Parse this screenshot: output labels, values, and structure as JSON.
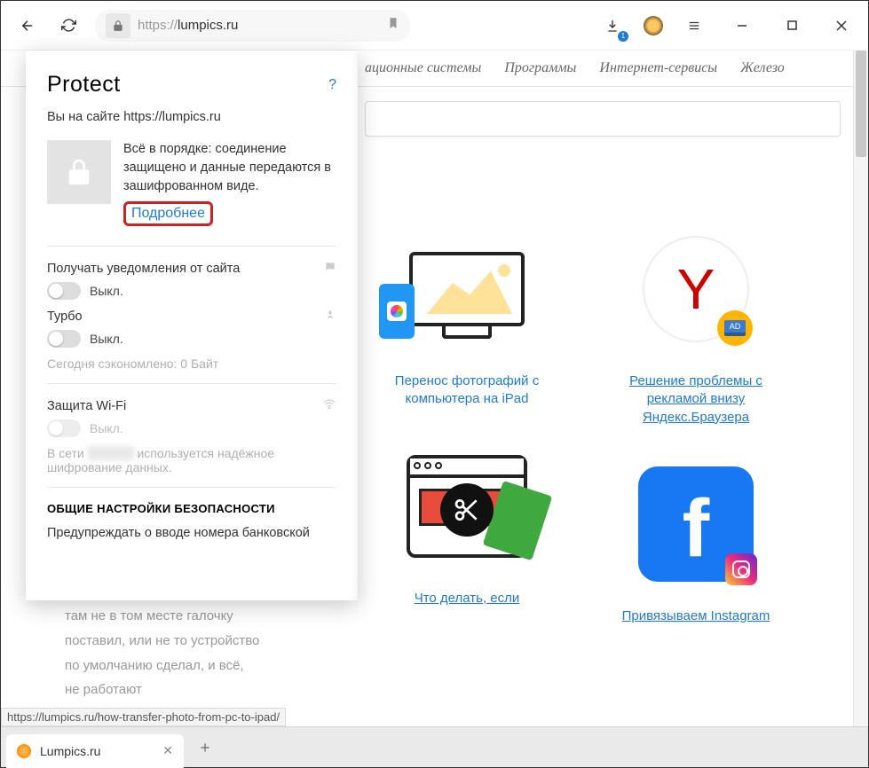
{
  "toolbar": {
    "url_prefix": "https://",
    "url_host": "lumpics.ru",
    "download_badge": "1"
  },
  "nav": {
    "items": [
      "ационные системы",
      "Программы",
      "Интернет-сервисы",
      "Железо"
    ]
  },
  "cards": [
    {
      "title": "Перенос фотографий с компьютера на iPad"
    },
    {
      "title": "Решение проблемы с рекламой внизу Яндекс.Браузера"
    },
    {
      "title": "Что делать, если"
    },
    {
      "title": "Привязываем Instagram"
    }
  ],
  "protect": {
    "title": "Protect",
    "help": "?",
    "site_line": "Вы на сайте https://lumpics.ru",
    "status_text": "Всё в порядке: соединение защищено и данные передаются в зашифрованном виде.",
    "details": "Подробнее",
    "notifications_label": "Получать уведомления от сайта",
    "off": "Выкл.",
    "turbo_label": "Турбо",
    "turbo_saved": "Сегодня сэкономлено: 0 Байт",
    "wifi_label": "Защита Wi-Fi",
    "wifi_net_prefix": "В сети ",
    "wifi_net_suffix": " используется надёжное шифрование данных.",
    "section_header": "ОБЩИЕ НАСТРОЙКИ БЕЗОПАСНОСТИ",
    "warn_card": "Предупреждать о вводе номера банковской"
  },
  "behind_text": "там не в том месте галочку поставил, или не то устройство по умолчанию сделал, и всё, не работают",
  "status_link": "https://lumpics.ru/how-transfer-photo-from-pc-to-ipad/",
  "tab": {
    "title": "Lumpics.ru"
  },
  "ad_label": "AD"
}
